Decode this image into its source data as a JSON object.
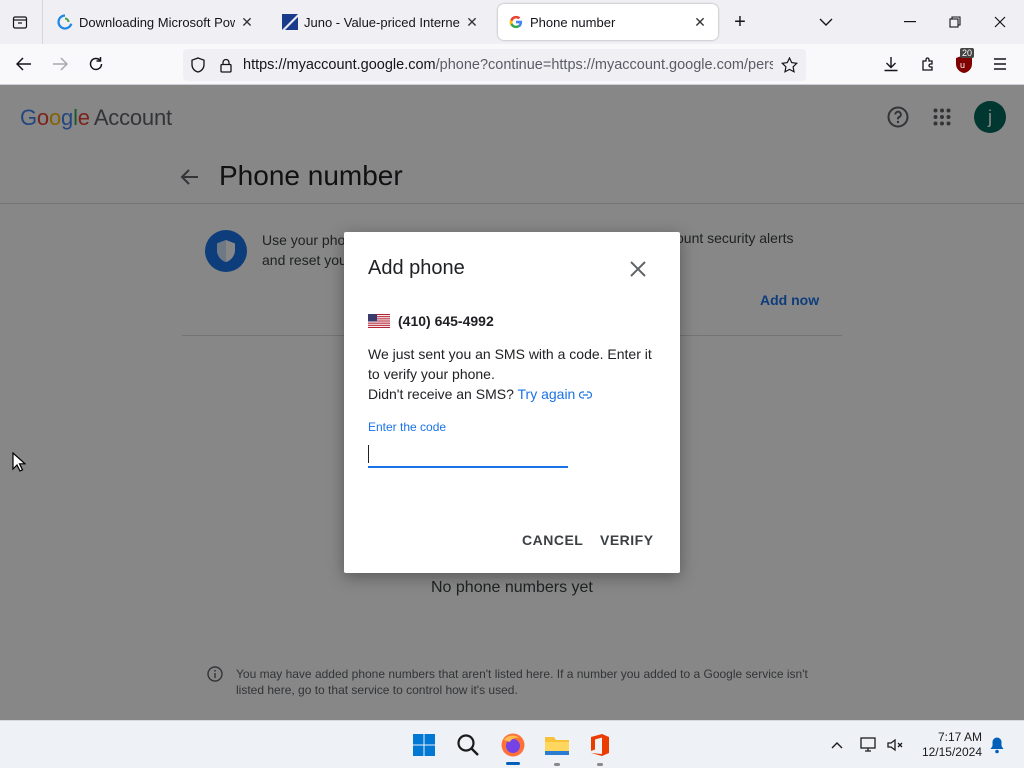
{
  "browser": {
    "tabs": [
      {
        "title": "Downloading Microsoft PowerPoint",
        "active": false
      },
      {
        "title": "Juno - Value-priced Internet Service",
        "active": false
      },
      {
        "title": "Phone number",
        "active": true
      }
    ],
    "url_host": "https://myaccount.google.com",
    "url_path": "/phone?continue=https://myaccount.google.com/personal-info",
    "extension_badge": "20"
  },
  "header": {
    "logo_google": "Google",
    "logo_account": "Account",
    "avatar_letter": "j"
  },
  "page": {
    "title": "Phone number",
    "info_line1": "Use your phone",
    "info_line2": "and reset you",
    "info_line1_end": "ount security alerts",
    "add_now": "Add now",
    "no_phones": "No phone numbers yet",
    "footer_note": "You may have added phone numbers that aren't listed here. If a number you added to a Google service isn't listed here, go to that service to control how it's used."
  },
  "dialog": {
    "title": "Add phone",
    "phone": "(410) 645-4992",
    "message": "We just sent you an SMS with a code. Enter it to verify your phone.",
    "resend_prompt": "Didn't receive an SMS?",
    "try_again": "Try again",
    "code_label": "Enter the code",
    "code_value": "",
    "cancel": "CANCEL",
    "verify": "VERIFY"
  },
  "taskbar": {
    "time": "7:17 AM",
    "date": "12/15/2024"
  },
  "colors": {
    "accent": "#1a73e8",
    "avatar": "#00695c"
  }
}
